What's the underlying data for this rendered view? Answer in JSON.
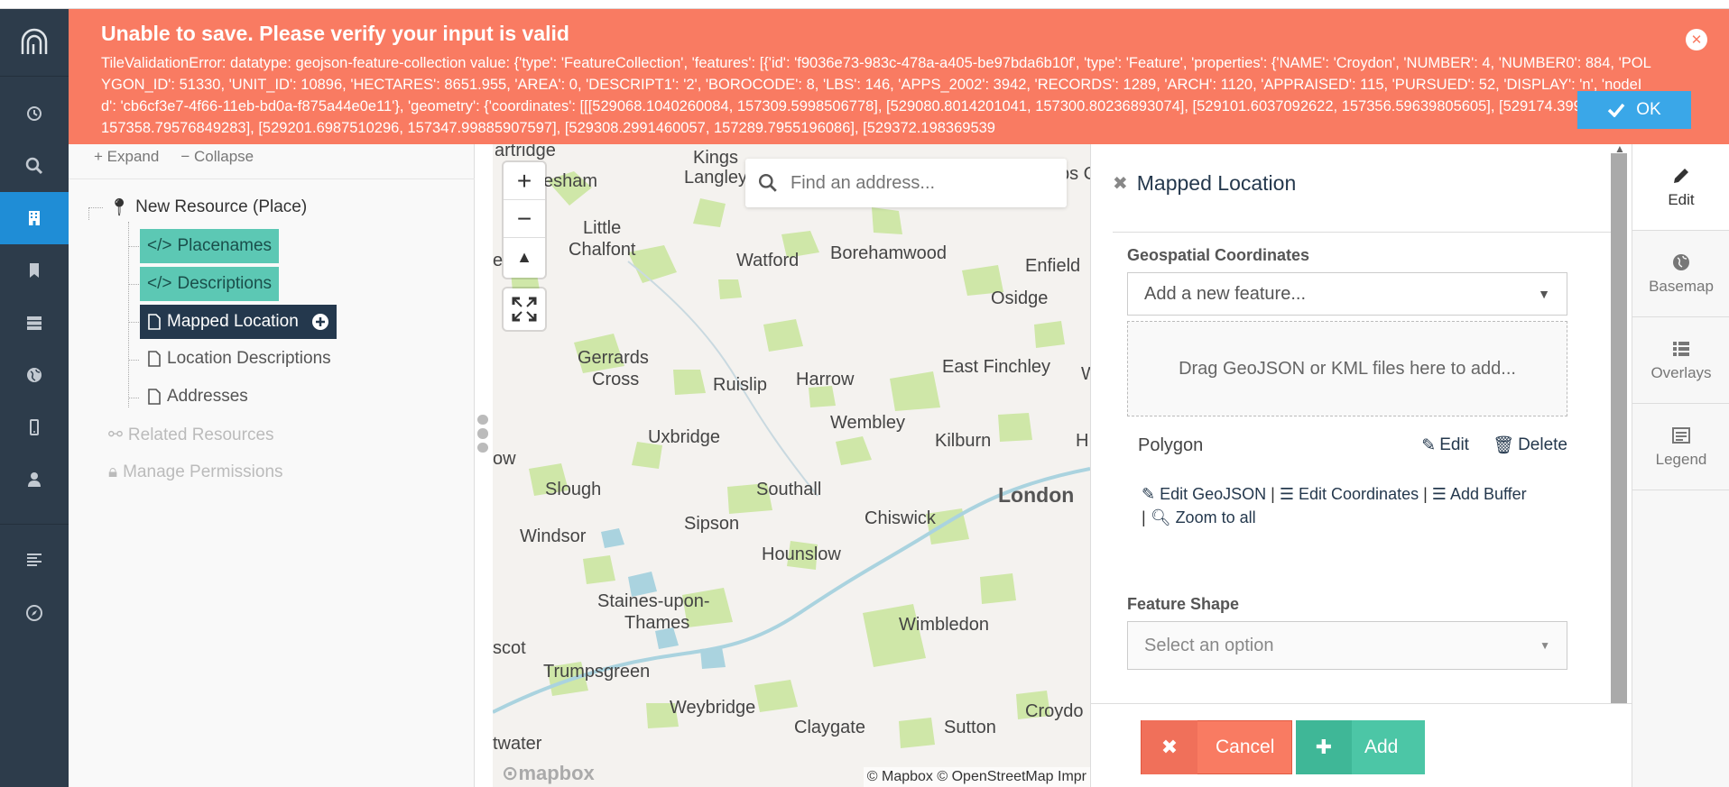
{
  "alert": {
    "title": "Unable to save. Please verify your input is valid",
    "message": "TileValidationError: datatype: geojson-feature-collection value: {'type': 'FeatureCollection', 'features': [{'id': 'f9036e73-983c-478a-a405-be97bda6b10f', 'type': 'Feature', 'properties': {'NAME': 'Croydon', 'NUMBER': 4, 'NUMBER0': 884, 'POLYGON_ID': 51330, 'UNIT_ID': 10896, 'HECTARES': 8651.955, 'AREA': 0, 'DESCRIPT1': '2', 'BOROCODE': 8, 'LBS': 146, 'APPS_2002': 3942, 'RECORDS': 1289, 'ARCH': 1120, 'APPRAISED': 115, 'PURSUED': 52, 'DISPLAY': 'n', 'nodeId': 'cb6cf3e7-4f66-11eb-bd0a-f875a44e0e11'}, 'geometry': {'coordinates': [[[529068.1040260084, 157309.5998506778], [529080.8014201041, 157300.80236893074], [529101.6037092622, 157356.59639805605], [529174.3993537237, 157358.79576849283], [529201.6987510296, 157347.99885907597], [529308.2991460057, 157289.7955196086], [529372.198369539",
    "ok_label": "OK"
  },
  "tree": {
    "expand_label": "Expand",
    "collapse_label": "Collapse",
    "root": "New Resource (Place)",
    "cards": [
      "Placenames",
      "Descriptions",
      "Mapped Location",
      "Location Descriptions",
      "Addresses"
    ],
    "related": "Related Resources",
    "permissions": "Manage Permissions"
  },
  "map": {
    "search_placeholder": "Find an address...",
    "attribution": "© Mapbox © OpenStreetMap Impr",
    "logo_text": "mapbox",
    "places": [
      "artridge",
      "Kings",
      "Langley",
      "esham",
      "Little",
      "Chalfont",
      "Watford",
      "Borehamwood",
      "Enfield",
      "Osidge",
      "Gerrards",
      "Cross",
      "Ruislip",
      "Harrow",
      "East Finchley",
      "Uxbridge",
      "Wembley",
      "Kilburn",
      "ow",
      "Slough",
      "Southall",
      "London",
      "Chiswick",
      "Windsor",
      "Sipson",
      "Hounslow",
      "Staines-upon-",
      "Thames",
      "Wimbledon",
      "scot",
      "Trumpsgreen",
      "Weybridge",
      "Claygate",
      "Sutton",
      "Croydo",
      "twater",
      "en",
      "bs C",
      "W",
      "H"
    ]
  },
  "editor": {
    "title": "Mapped Location",
    "geo_label": "Geospatial Coordinates",
    "add_feature": "Add a new feature...",
    "dropzone": "Drag GeoJSON or KML files here to add...",
    "feature_name": "Polygon",
    "edit_label": "Edit",
    "delete_label": "Delete",
    "edit_geojson": "Edit GeoJSON",
    "edit_coords": "Edit Coordinates",
    "add_buffer": "Add Buffer",
    "zoom_all": "Zoom to all",
    "shape_label": "Feature Shape",
    "shape_placeholder": "Select an option",
    "cancel_label": "Cancel",
    "add_label": "Add"
  },
  "rail": {
    "items": [
      "Edit",
      "Basemap",
      "Overlays",
      "Legend"
    ]
  },
  "colors": {
    "nav": "#2d3c4b",
    "nav_active": "#1f8dd6",
    "alert": "#f97b62",
    "teal": "#5cc8b4",
    "selected": "#24384d",
    "add": "#4cc6a6"
  }
}
